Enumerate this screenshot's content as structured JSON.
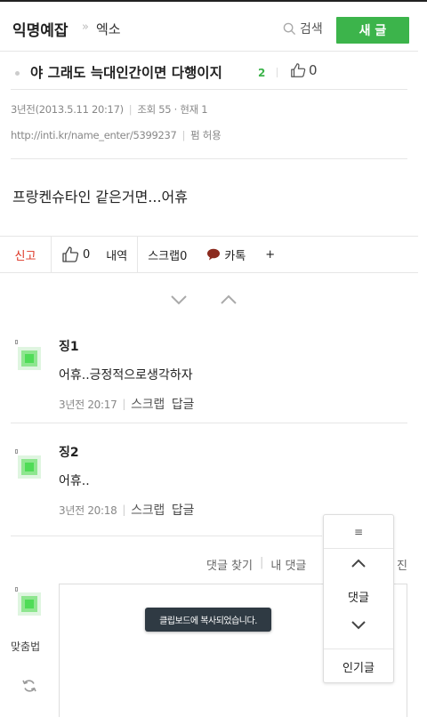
{
  "header": {
    "title": "익명예잡",
    "separator": "»",
    "board": "엑소",
    "search_label": "검색",
    "new_post_label": "새 글"
  },
  "post": {
    "title": "야 그래도 늑대인간이면 다행이지",
    "comment_count": "2",
    "like_count": "0",
    "time_ago": "3년전",
    "datetime": "(2013.5.11 20:17)",
    "views_label": "조회 55 · 현재 1",
    "url": "http://inti.kr/name_enter/5399237",
    "share_label": "펌 허용",
    "body": "프랑켄슈타인 같은거면...어휴"
  },
  "actions": {
    "report": "신고",
    "like_count": "0",
    "history": "내역",
    "scrap": "스크랩0",
    "kakao": "카톡",
    "more": "+"
  },
  "comments": [
    {
      "name": "징1",
      "text": "어휴..긍정적으로생각하자",
      "time": "3년전 20:17",
      "scrap": "스크랩",
      "reply": "답글"
    },
    {
      "name": "징2",
      "text": "어휴..",
      "time": "3년전 20:18",
      "scrap": "스크랩",
      "reply": "답글"
    }
  ],
  "comment_nav": {
    "find_comment": "댓글 찾기",
    "my_comment": "내 댓글",
    "edge_char": "진"
  },
  "editor": {
    "spell_check": "맞춤법"
  },
  "toast": "클립보드에 복사되었습니다.",
  "float_panel": {
    "menu_icon": "≡",
    "label": "댓글",
    "popular": "인기글"
  },
  "colors": {
    "accent_green": "#3cb44b",
    "report_red": "#dd3322",
    "toast_bg": "#2f3a43"
  }
}
